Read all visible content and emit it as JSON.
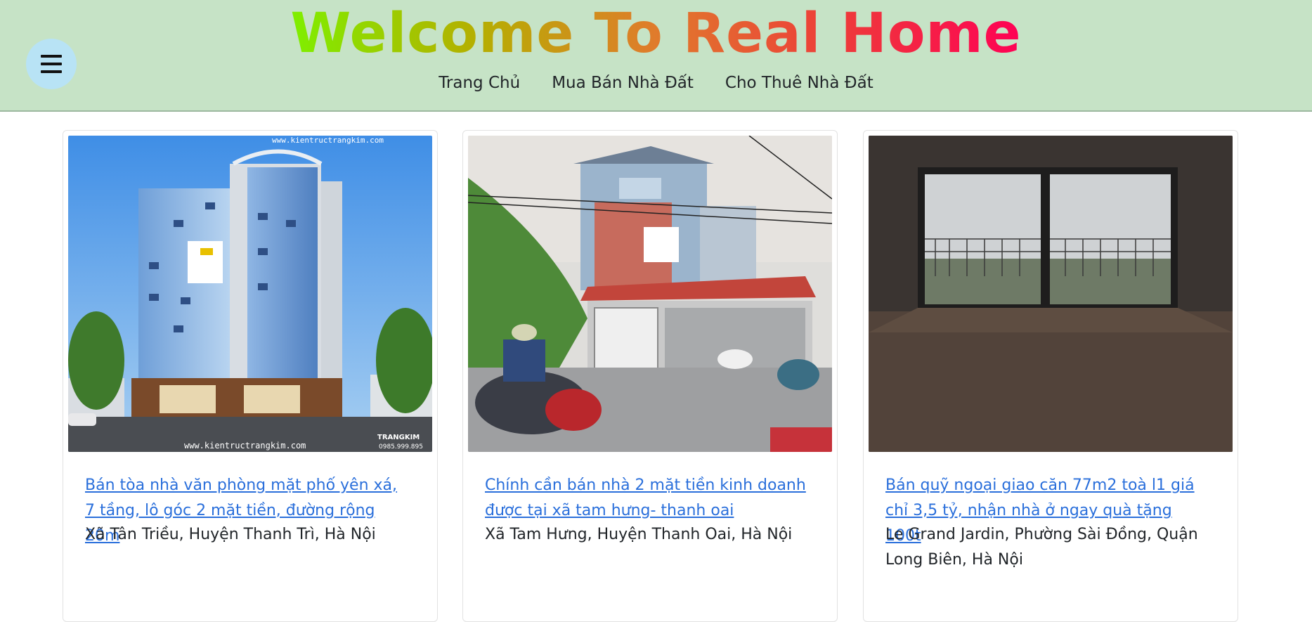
{
  "header": {
    "title": "Welcome To Real Home",
    "nav": [
      "Trang Chủ",
      "Mua Bán Nhà Đất",
      "Cho Thuê Nhà Đất"
    ]
  },
  "listings": [
    {
      "title": "Bán tòa nhà văn phòng mặt phố yên xá, 7 tầng, lô góc 2 mặt tiền, đường rộng 20m",
      "address": "Xã Tân Triều, Huyện Thanh Trì, Hà Nội",
      "watermark_top": "www.kientructrangkim.com",
      "watermark_bottom": "www.kientructrangkim.com",
      "brand": "TRANGKIM",
      "phone": "0985.999.895"
    },
    {
      "title": "Chính cần bán nhà 2 mặt tiền kinh doanh được tại xã tam hưng- thanh oai",
      "address": "Xã Tam Hưng, Huyện Thanh Oai, Hà Nội"
    },
    {
      "title": "Bán quỹ ngoại giao căn 77m2 toà l1 giá chỉ 3,5 tỷ, nhận nhà ở ngay quà tặng 100t",
      "address": "Le Grand Jardin, Phường Sài Đồng, Quận Long Biên, Hà Nội"
    }
  ]
}
